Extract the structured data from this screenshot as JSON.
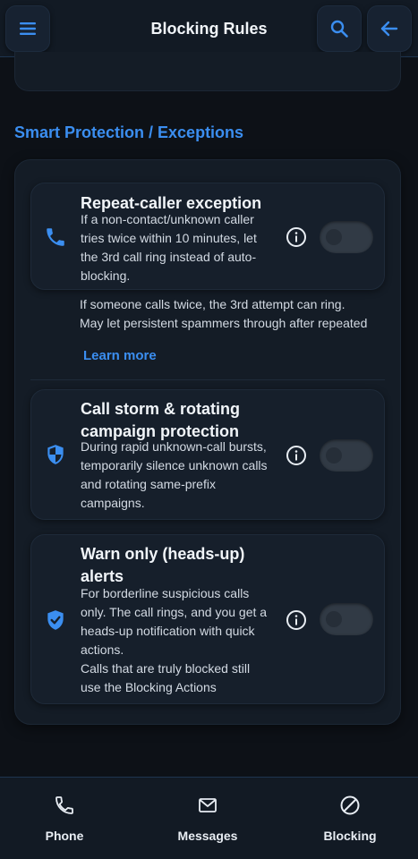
{
  "header": {
    "title": "Blocking Rules",
    "menu_icon": "hamburger-menu-icon",
    "search_icon": "search-icon",
    "back_icon": "arrow-left-icon"
  },
  "section": {
    "title": "Smart Protection / Exceptions"
  },
  "rules": [
    {
      "title": "Repeat-caller exception",
      "description": "If a non-contact/unknown caller tries twice within 10 minutes, let the 3rd call ring instead of auto-blocking.",
      "icon": "phone-icon",
      "enabled": false,
      "extra_lines": [
        "If someone calls twice, the 3rd attempt can ring.",
        "May let persistent spammers through after repeated"
      ],
      "learn_more": "Learn more"
    },
    {
      "title": "Call storm & rotating campaign protection",
      "description": "During rapid unknown-call bursts, temporarily silence unknown calls and rotating same-prefix campaigns.",
      "icon": "shield-icon",
      "enabled": false
    },
    {
      "title": "Warn only (heads-up) alerts",
      "description": "For borderline suspicious calls only. The call rings, and you get a heads-up notification with quick actions.",
      "description_2": "Calls that are truly blocked still use the Blocking Actions",
      "icon": "verified-shield-icon",
      "enabled": false
    }
  ],
  "bottom_nav": [
    {
      "label": "Phone",
      "icon": "phone-icon"
    },
    {
      "label": "Messages",
      "icon": "mail-icon"
    },
    {
      "label": "Blocking",
      "icon": "block-icon"
    }
  ],
  "colors": {
    "accent": "#3b8ef0",
    "background": "#0d1117",
    "card": "#141c26",
    "toggle_off": "#313a45"
  }
}
